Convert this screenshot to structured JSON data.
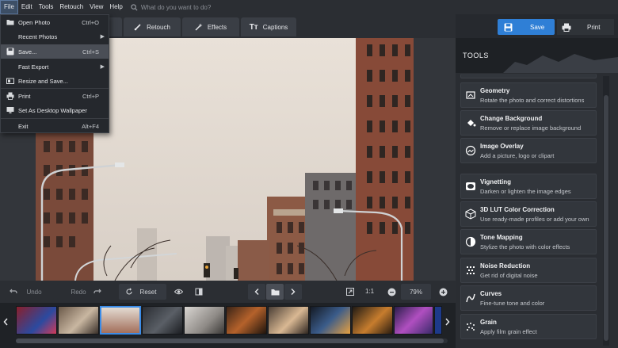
{
  "menubar": {
    "items": [
      "File",
      "Edit",
      "Tools",
      "Retouch",
      "View",
      "Help"
    ],
    "search_placeholder": "What do you want to do?"
  },
  "tabs": {
    "retouch": "Retouch",
    "effects": "Effects",
    "captions": "Captions"
  },
  "actions": {
    "save": "Save",
    "print": "Print"
  },
  "file_menu": {
    "items": [
      {
        "label": "Open Photo",
        "shortcut": "Ctrl+O"
      },
      {
        "label": "Recent Photos",
        "submenu": "▶"
      },
      {
        "label": "Save...",
        "shortcut": "Ctrl+S"
      },
      {
        "label": "Fast Export",
        "submenu": "▶"
      },
      {
        "label": "Resize and Save..."
      },
      {
        "label": "Print",
        "shortcut": "Ctrl+P"
      },
      {
        "label": "Set As Desktop Wallpaper"
      },
      {
        "label": "Exit",
        "shortcut": "Alt+F4"
      }
    ]
  },
  "tools_panel": {
    "title": "TOOLS",
    "items": [
      {
        "title": "Geometry",
        "desc": "Rotate the photo and correct distortions",
        "icon": "geometry-icon"
      },
      {
        "title": "Change Background",
        "desc": "Remove or replace image background",
        "icon": "paint-bucket-icon"
      },
      {
        "title": "Image Overlay",
        "desc": "Add a picture, logo or clipart",
        "icon": "image-overlay-icon"
      },
      {
        "title": "Vignetting",
        "desc": "Darken or lighten the image edges",
        "icon": "vignette-icon"
      },
      {
        "title": "3D LUT Color Correction",
        "desc": "Use ready-made profiles or add your own",
        "icon": "lut-cube-icon"
      },
      {
        "title": "Tone Mapping",
        "desc": "Stylize the photo with color effects",
        "icon": "tone-mapping-icon"
      },
      {
        "title": "Noise Reduction",
        "desc": "Get rid of digital noise",
        "icon": "noise-icon"
      },
      {
        "title": "Curves",
        "desc": "Fine-tune tone and color",
        "icon": "curves-icon"
      },
      {
        "title": "Grain",
        "desc": "Apply film grain effect",
        "icon": "grain-icon"
      }
    ]
  },
  "bottom": {
    "undo": "Undo",
    "redo": "Redo",
    "reset": "Reset",
    "ratio": "1:1",
    "zoom": "79%"
  },
  "colors": {
    "accent": "#2f7fd6",
    "panel_bg": "#2a2d32",
    "menu_highlight": "#4a4e56"
  }
}
